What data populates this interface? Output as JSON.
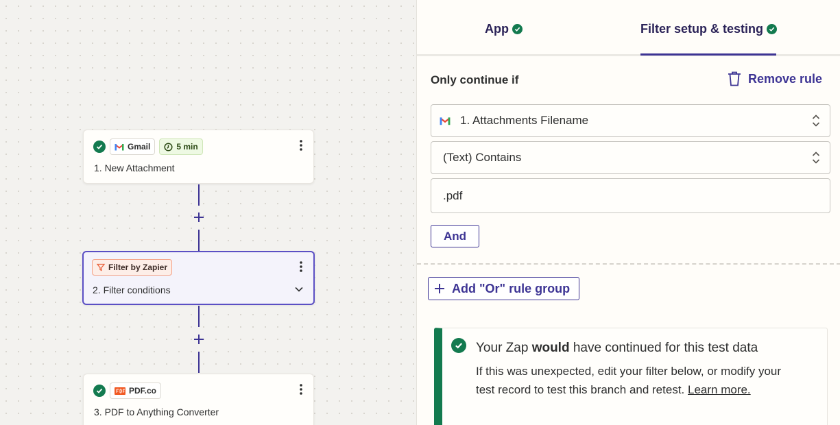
{
  "canvas": {
    "steps": [
      {
        "app": "Gmail",
        "delay": "5 min",
        "title": "1. New Attachment"
      },
      {
        "app": "Filter by Zapier",
        "title": "2. Filter conditions"
      },
      {
        "app": "PDF.co",
        "title": "3. PDF to Anything Converter"
      }
    ]
  },
  "panel": {
    "tabs": [
      {
        "label": "App"
      },
      {
        "label": "Filter setup & testing"
      }
    ],
    "rule_heading": "Only continue if",
    "remove_rule": "Remove rule",
    "field_name": "1. Attachments Filename",
    "condition": "(Text) Contains",
    "value": ".pdf",
    "and_label": "And",
    "or_label": "Add \"Or\" rule group",
    "result": {
      "title_pre": "Your Zap ",
      "title_bold": "would",
      "title_post": " have continued for this test data",
      "body": "If this was unexpected, edit your filter below, or modify your test record to test this branch and retest. ",
      "link": "Learn more."
    }
  },
  "colors": {
    "accent": "#3d3494",
    "success": "#137a4f",
    "filter_chip": "#f4a287"
  },
  "icons": [
    "check-icon",
    "gmail-icon",
    "clock-icon",
    "more-vertical-icon",
    "plus-icon",
    "filter-icon",
    "chevron-down-icon",
    "pdf-icon",
    "trash-icon",
    "sort-arrows-icon"
  ]
}
